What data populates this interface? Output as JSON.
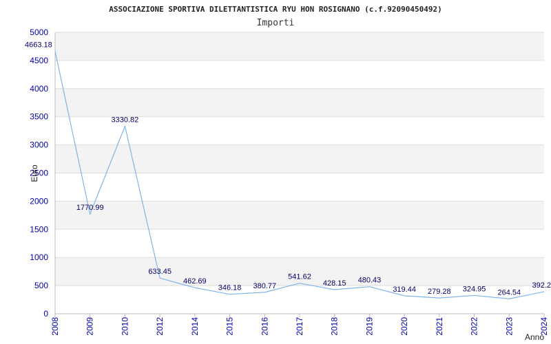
{
  "colors": {
    "line": "#7fb3e6",
    "band": "#f3f3f3",
    "grid": "#dddddd",
    "axis": "#bbbbbb",
    "tick_text": "#0000aa",
    "data_label": "#000066"
  },
  "chart_data": {
    "type": "line",
    "title": "ASSOCIAZIONE SPORTIVA DILETTANTISTICA RYU HON ROSIGNANO (c.f.92090450492)",
    "subtitle": "Importi",
    "ylabel": "Euro",
    "xlabel": "Anno",
    "ylim": [
      0,
      5000
    ],
    "yticks": [
      0,
      500,
      1000,
      1500,
      2000,
      2500,
      3000,
      3500,
      4000,
      4500,
      5000
    ],
    "grid": true,
    "legend": "none",
    "x": [
      "2008",
      "2009",
      "2010",
      "2012",
      "2014",
      "2015",
      "2016",
      "2017",
      "2018",
      "2019",
      "2020",
      "2021",
      "2022",
      "2023",
      "2024"
    ],
    "series": [
      {
        "values": [
          4663.18,
          1770.99,
          3330.82,
          633.45,
          462.69,
          346.18,
          380.77,
          541.62,
          428.15,
          480.43,
          319.44,
          279.28,
          324.95,
          264.54,
          392.2
        ],
        "labels": [
          "4663.18",
          "1770.99",
          "3330.82",
          "633.45",
          "462.69",
          "346.18",
          "380.77",
          "541.62",
          "428.15",
          "480.43",
          "319.44",
          "279.28",
          "324.95",
          "264.54",
          "392.2"
        ]
      }
    ]
  }
}
